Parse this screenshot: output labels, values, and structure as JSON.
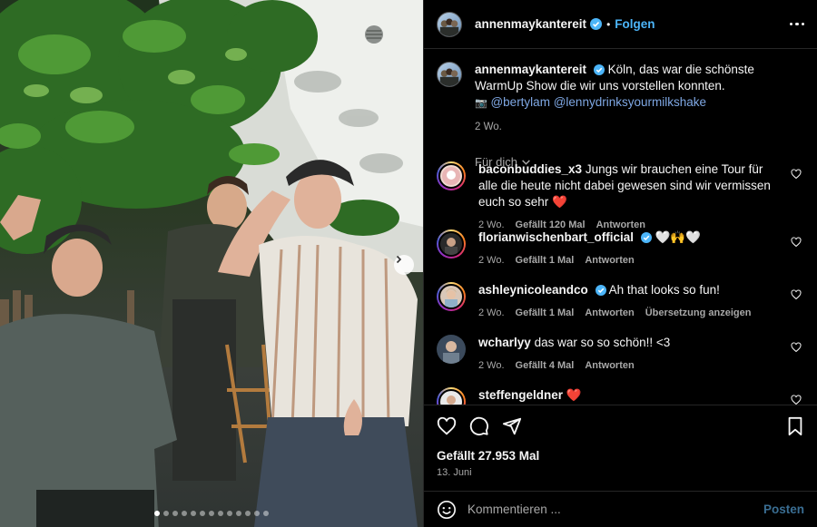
{
  "post": {
    "author": "annenmaykantereit",
    "follow_label": "Folgen",
    "separator": "•",
    "caption_text": "Köln, das war die schönste WarmUp Show die wir uns vorstellen konnten.",
    "camera_emoji": "📷",
    "mention_1": "@bertylam",
    "mention_2": "@lennydrinksyourmilkshake",
    "caption_time": "2 Wo.",
    "sort_label": "Für dich",
    "likes_label": "Gefällt 27.953 Mal",
    "date": "13. Juni",
    "carousel": {
      "count": 13,
      "active_index": 0
    }
  },
  "comments": [
    {
      "user": "baconbuddies_x3",
      "verified": false,
      "text": "Jungs wir brauchen eine Tour für alle die heute nicht dabei gewesen sind wir vermissen euch so sehr ❤️",
      "time": "2 Wo.",
      "likes": "Gefällt 120 Mal",
      "reply": "Antworten"
    },
    {
      "user": "florianwischenbart_official",
      "verified": true,
      "text": "🤍🙌🤍",
      "time": "2 Wo.",
      "likes": "Gefällt 1 Mal",
      "reply": "Antworten"
    },
    {
      "user": "ashleynicoleandco",
      "verified": true,
      "text": "Ah that looks so fun!",
      "time": "2 Wo.",
      "likes": "Gefällt 1 Mal",
      "reply": "Antworten",
      "translate": "Übersetzung anzeigen"
    },
    {
      "user": "wcharlyy",
      "verified": false,
      "text": "das war so so schön!! <3",
      "time": "2 Wo.",
      "likes": "Gefällt 4 Mal",
      "reply": "Antworten"
    },
    {
      "user": "steffengeldner",
      "verified": false,
      "text": "❤️",
      "time": "",
      "likes": "",
      "reply": ""
    }
  ],
  "composer": {
    "placeholder": "Kommentieren ...",
    "post_label": "Posten"
  },
  "colors": {
    "accent": "#4cb5f9",
    "mention": "#7fa8e4",
    "heart_red": "#ed4956",
    "muted": "#a8a8a8"
  },
  "icons": [
    "verified-badge-icon",
    "more-options-icon",
    "chevron-down-icon",
    "heart-outline-icon",
    "comment-icon",
    "share-icon",
    "bookmark-icon",
    "emoji-icon",
    "carousel-next-icon"
  ]
}
